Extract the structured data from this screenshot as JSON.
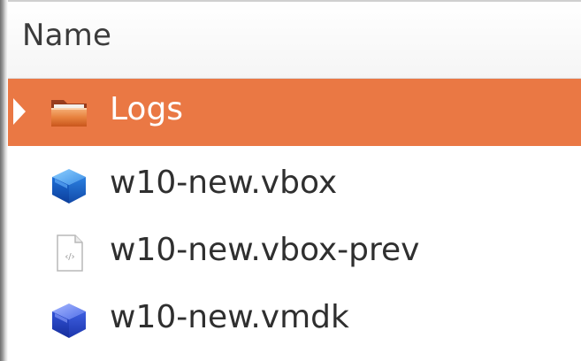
{
  "columns": {
    "name_header": "Name"
  },
  "files": [
    {
      "name": "Logs",
      "icon": "folder-icon",
      "selected": true,
      "expandable": true
    },
    {
      "name": "w10-new.vbox",
      "icon": "virtualbox-icon",
      "selected": false,
      "expandable": false
    },
    {
      "name": "w10-new.vbox-prev",
      "icon": "xml-file-icon",
      "selected": false,
      "expandable": false
    },
    {
      "name": "w10-new.vmdk",
      "icon": "virtualbox-disk-icon",
      "selected": false,
      "expandable": false
    }
  ],
  "colors": {
    "selection": "#ea7844",
    "text": "#2f2f2f",
    "selected_text": "#ffffff"
  }
}
